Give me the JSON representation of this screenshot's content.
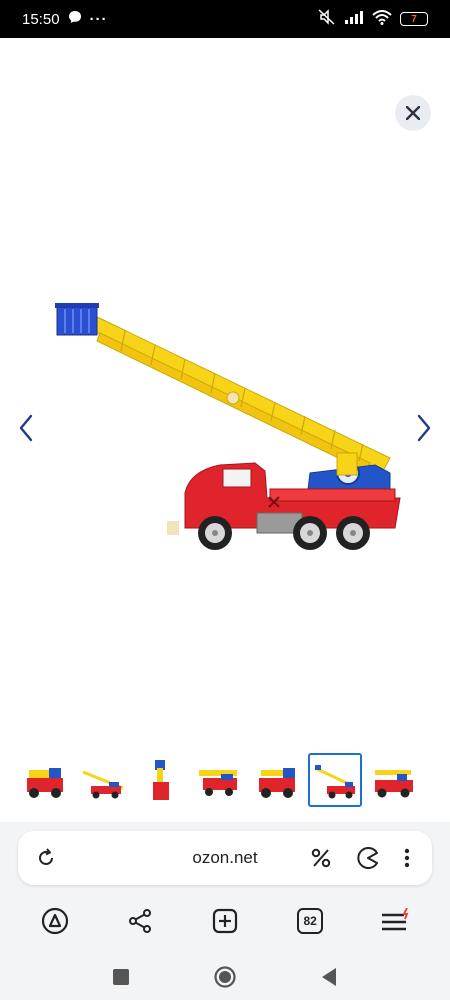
{
  "status_bar": {
    "time": "15:50",
    "battery_level": "7",
    "icons": [
      "message-icon",
      "more-dots-icon",
      "mute-icon",
      "signal-icon",
      "wifi-icon",
      "battery-icon"
    ]
  },
  "viewer": {
    "image_subject": "Red toy fire truck with yellow extending ladder",
    "thumbnail_count": 7,
    "active_thumbnail": 6
  },
  "browser": {
    "url": "ozon.net",
    "tab_count": "82"
  },
  "colors": {
    "truck_red": "#e0242c",
    "ladder_yellow": "#f7d417",
    "cab_blue": "#2255c8",
    "active_thumb": "#1b6fd6",
    "close_bg": "#e9edf2"
  }
}
